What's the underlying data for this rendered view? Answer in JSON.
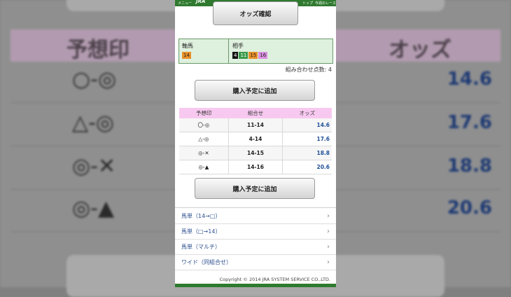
{
  "background": {
    "header_mark": "予想印",
    "header_odds": "オッズ",
    "rows": [
      {
        "mark": "○-◎",
        "odds": "14.6"
      },
      {
        "mark": "△-◎",
        "odds": "17.6"
      },
      {
        "mark": "◎-✕",
        "odds": "18.8"
      },
      {
        "mark": "◎-▲",
        "odds": "20.6"
      }
    ]
  },
  "nav": {
    "menu": "メニュー",
    "top": "トップ",
    "race": "今週のレース"
  },
  "odds_button": "オッズ確認",
  "selection": {
    "axis_label": "軸馬",
    "axis_horse": "14",
    "partner_label": "相手",
    "partners": [
      {
        "num": "4",
        "color": "#111111"
      },
      {
        "num": "11",
        "color": "#3a9a4a"
      },
      {
        "num": "15",
        "color": "#e8902a"
      },
      {
        "num": "16",
        "color": "#d98fe0"
      }
    ],
    "axis_color": "#e8902a"
  },
  "count_text": "組み合わせ点数: 4",
  "add_button_label": "購入予定に追加",
  "table": {
    "headers": [
      "予想印",
      "組合せ",
      "オッズ"
    ],
    "rows": [
      {
        "mark": "〇-◎",
        "combo": "11-14",
        "odds": "14.6"
      },
      {
        "mark": "△-◎",
        "combo": "4-14",
        "odds": "17.6"
      },
      {
        "mark": "◎-✕",
        "combo": "14-15",
        "odds": "18.8"
      },
      {
        "mark": "◎-▲",
        "combo": "14-16",
        "odds": "20.6"
      }
    ]
  },
  "links": [
    "馬単（14→□）",
    "馬単（□→14）",
    "馬単（マルチ）",
    "ワイド（同組合せ）"
  ],
  "copyright": "Copyright © 2014 JRA SYSTEM SERVICE CO.,LTD."
}
